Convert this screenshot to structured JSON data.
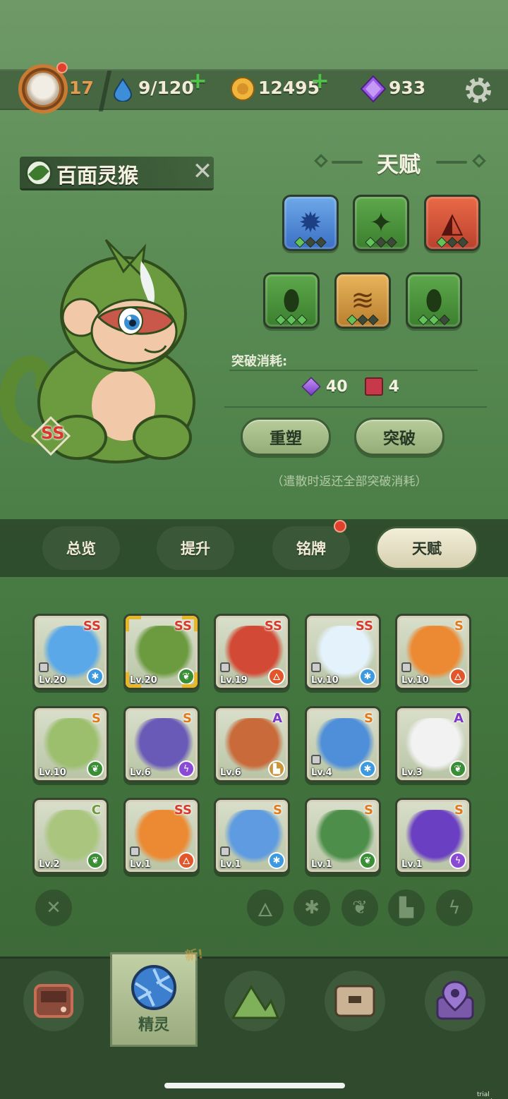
{
  "header": {
    "level": "17",
    "energy": "9/120",
    "coins": "12495",
    "gems": "933",
    "plus_symbol": "+"
  },
  "creature": {
    "name": "百面灵猴",
    "rank": "SS"
  },
  "talent": {
    "title": "天赋",
    "cost_label": "突破消耗:",
    "cost_gems": "40",
    "cost_books": "4",
    "reshape_label": "重塑",
    "breakthrough_label": "突破",
    "note": "（遣散时返还全部突破消耗）",
    "slots": [
      {
        "icon": "blue-gear-icon",
        "color": "blue",
        "glyph": "✹",
        "filled": 1
      },
      {
        "icon": "green-spike-icon",
        "color": "green",
        "glyph": "✦",
        "filled": 1
      },
      {
        "icon": "red-fangs-icon",
        "color": "red",
        "glyph": "◭",
        "filled": 1
      },
      {
        "icon": "green-drop-icon",
        "color": "green",
        "glyph": "⬮",
        "filled": 3
      },
      {
        "icon": "gold-stack-icon",
        "color": "gold",
        "glyph": "≋",
        "filled": 1
      },
      {
        "icon": "green-drop-icon",
        "color": "green",
        "glyph": "⬮",
        "filled": 2
      }
    ]
  },
  "tabs": [
    {
      "label": "总览",
      "active": false
    },
    {
      "label": "提升",
      "active": false
    },
    {
      "label": "铭牌",
      "active": false
    },
    {
      "label": "天赋",
      "active": true
    }
  ],
  "cards": [
    {
      "rank": "SS",
      "level": "Lv.20",
      "element": "ice",
      "color": "#5aa8e8",
      "locked": true
    },
    {
      "rank": "SS",
      "level": "Lv.20",
      "element": "leaf",
      "color": "#6b9a3f",
      "locked": false,
      "selected": true
    },
    {
      "rank": "SS",
      "level": "Lv.19",
      "element": "fire",
      "color": "#d24a35",
      "locked": true
    },
    {
      "rank": "SS",
      "level": "Lv.10",
      "element": "ice",
      "color": "#e3f2fb",
      "locked": true
    },
    {
      "rank": "S",
      "level": "Lv.10",
      "element": "fire",
      "color": "#ec8a34",
      "locked": true
    },
    {
      "rank": "S",
      "level": "Lv.10",
      "element": "leaf",
      "color": "#9cbf6e",
      "locked": false
    },
    {
      "rank": "S",
      "level": "Lv.6",
      "element": "bolt",
      "color": "#6a5ab8",
      "locked": false
    },
    {
      "rank": "A",
      "level": "Lv.6",
      "element": "rock",
      "color": "#c96a3a",
      "locked": false
    },
    {
      "rank": "S",
      "level": "Lv.4",
      "element": "ice",
      "color": "#4f8fd9",
      "locked": true
    },
    {
      "rank": "A",
      "level": "Lv.3",
      "element": "leaf",
      "color": "#f2f2f2",
      "locked": false
    },
    {
      "rank": "C",
      "level": "Lv.2",
      "element": "leaf",
      "color": "#a9c57e",
      "locked": false
    },
    {
      "rank": "SS",
      "level": "Lv.1",
      "element": "fire",
      "color": "#ec8a34",
      "locked": true
    },
    {
      "rank": "S",
      "level": "Lv.1",
      "element": "ice",
      "color": "#5e9be0",
      "locked": true
    },
    {
      "rank": "S",
      "level": "Lv.1",
      "element": "leaf",
      "color": "#4d8f4a",
      "locked": false
    },
    {
      "rank": "S",
      "level": "Lv.1",
      "element": "bolt",
      "color": "#6b3fc2",
      "locked": false
    }
  ],
  "filters": [
    "close-icon",
    "fire-icon",
    "ice-icon",
    "leaf-icon",
    "rock-icon",
    "bolt-icon"
  ],
  "nav": {
    "active_label": "精灵",
    "new_badge": "新!"
  },
  "watermark": "trial version"
}
